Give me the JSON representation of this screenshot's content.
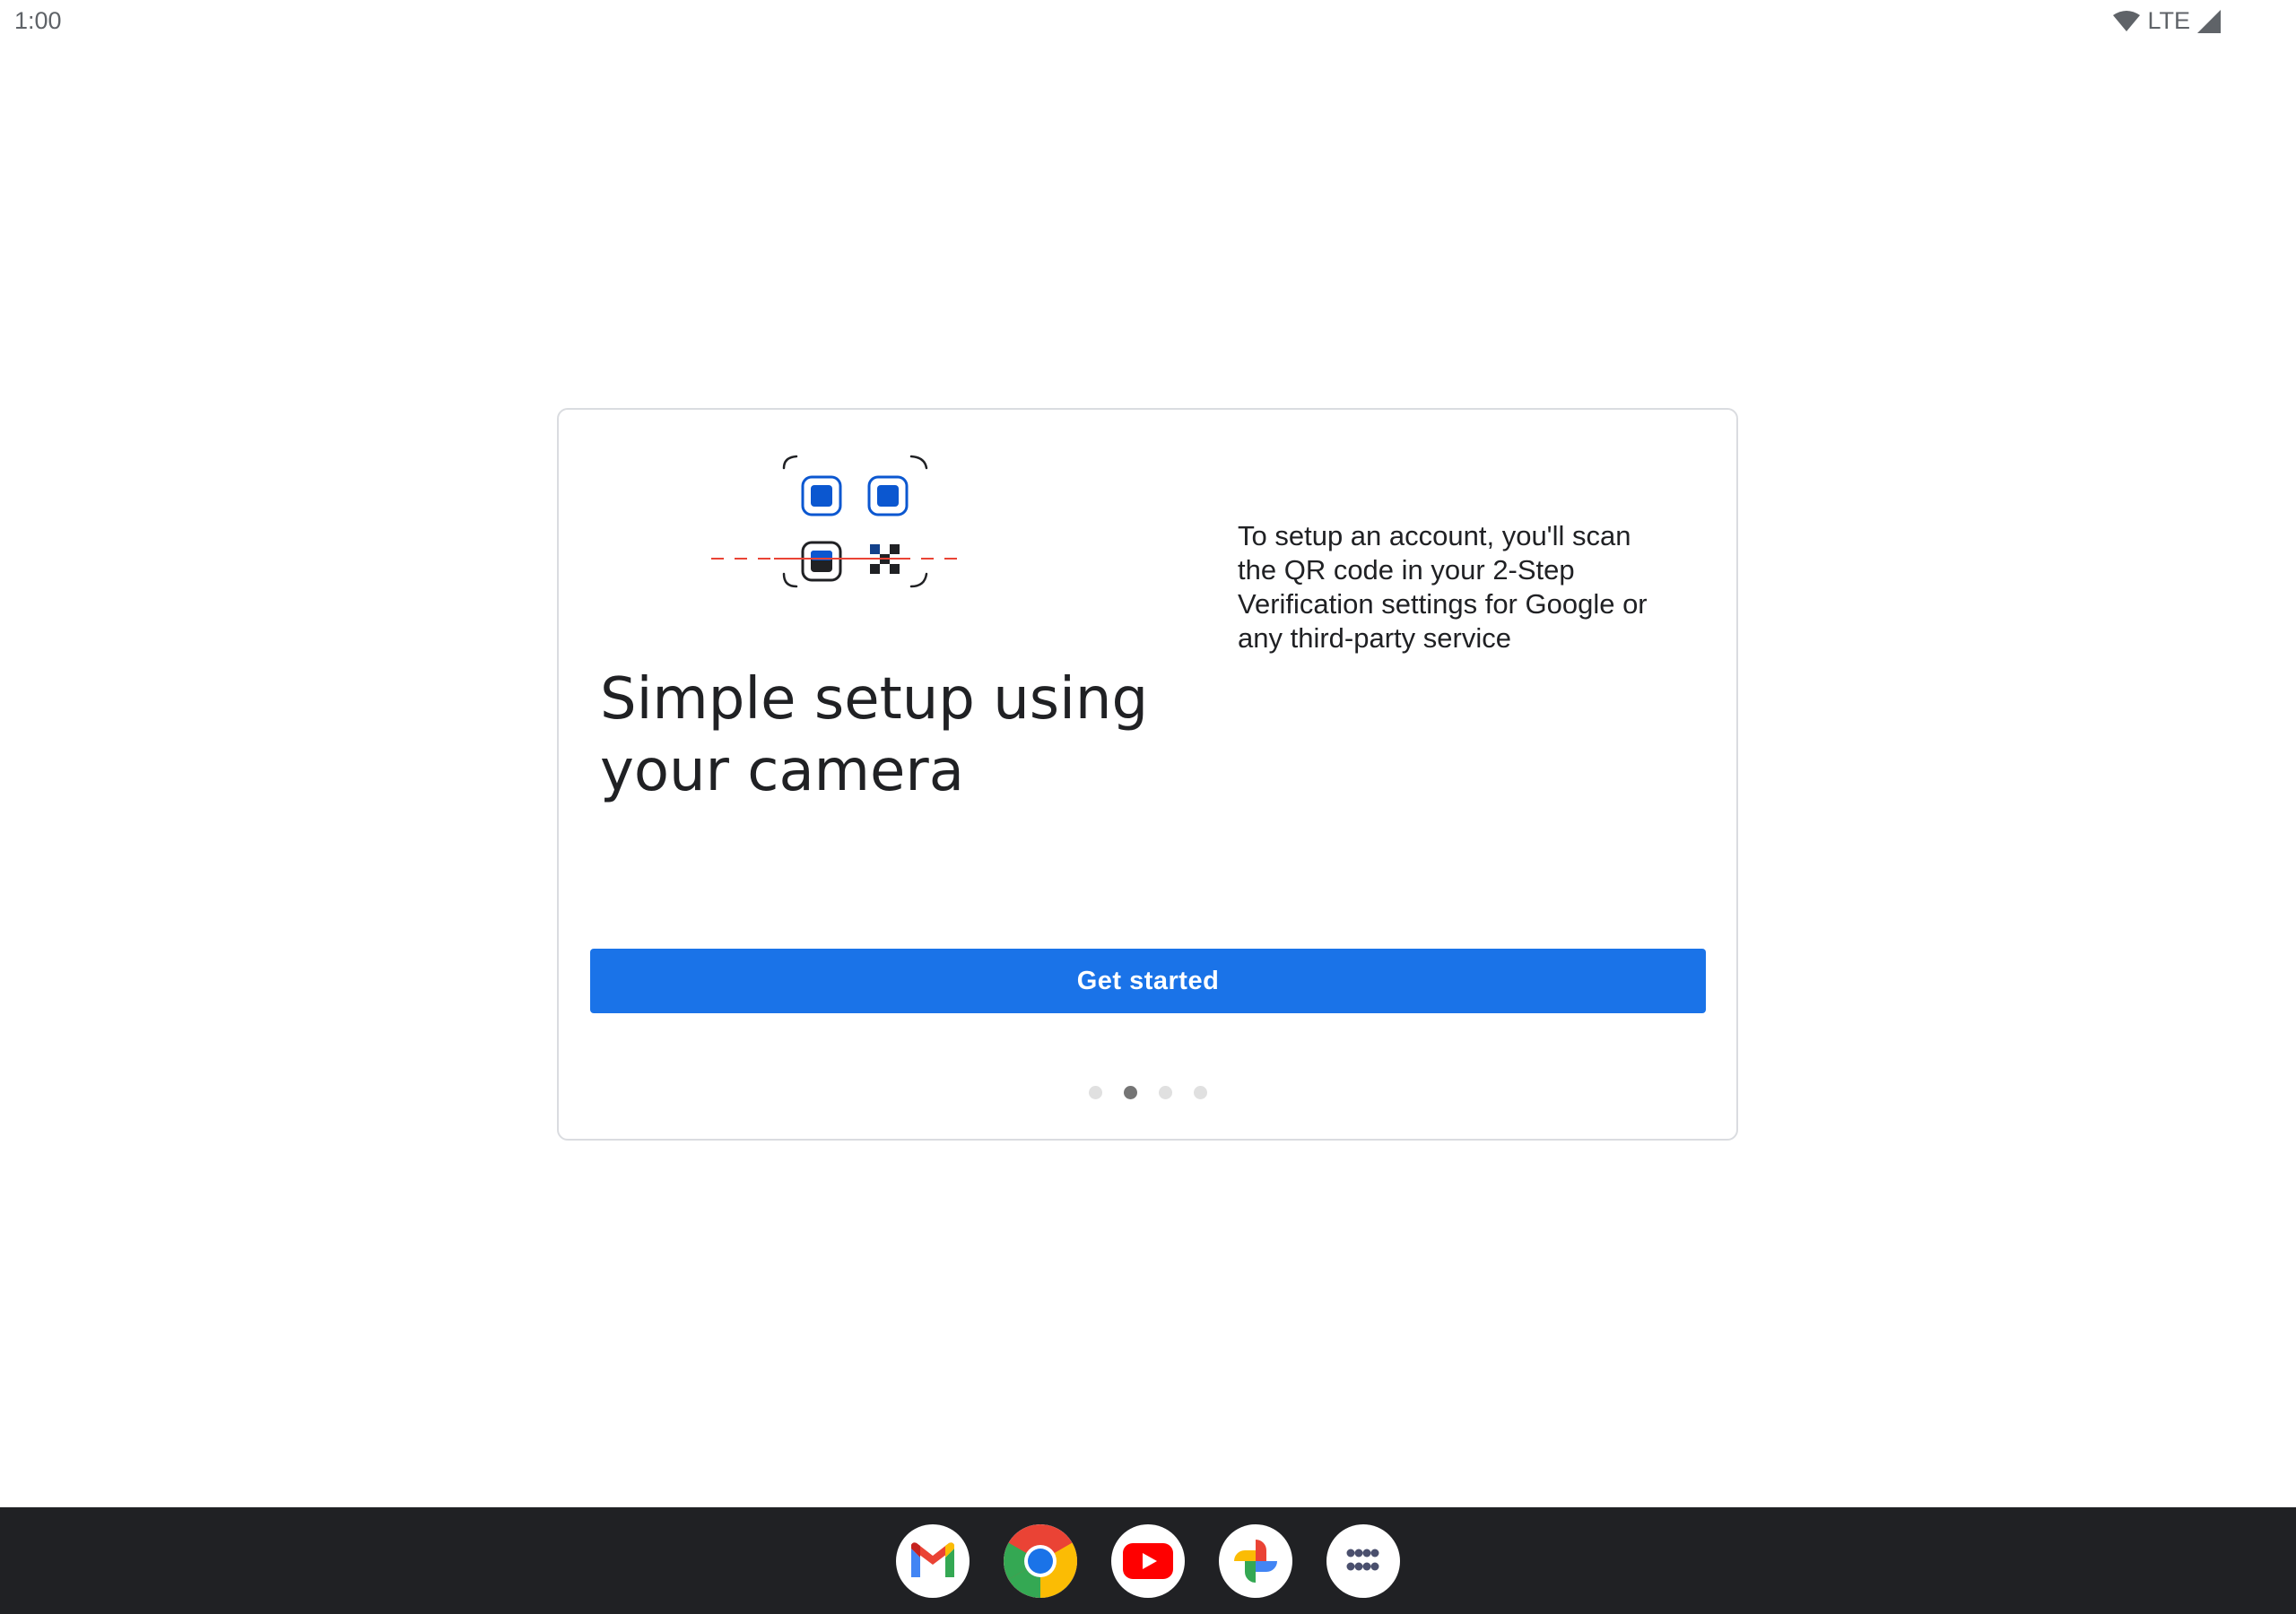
{
  "status_bar": {
    "time": "1:00",
    "network": "LTE",
    "icons": [
      "wifi-icon",
      "signal-icon"
    ]
  },
  "onboarding": {
    "illustration": "qr-scan-illustration",
    "headline": "Simple setup using your camera",
    "description": "To setup an account, you'll scan the QR code in your 2-Step Verification settings for Google or any third-party service",
    "primary_button_label": "Get started",
    "page_count": 4,
    "current_page": 2
  },
  "taskbar": {
    "apps": [
      "gmail-icon",
      "chrome-icon",
      "youtube-icon",
      "photos-icon",
      "app-drawer-icon"
    ]
  },
  "colors": {
    "accent": "#1a73e8",
    "taskbar_bg": "#202124",
    "qr_blue": "#0b57d0",
    "scan_line": "#ea4335"
  }
}
